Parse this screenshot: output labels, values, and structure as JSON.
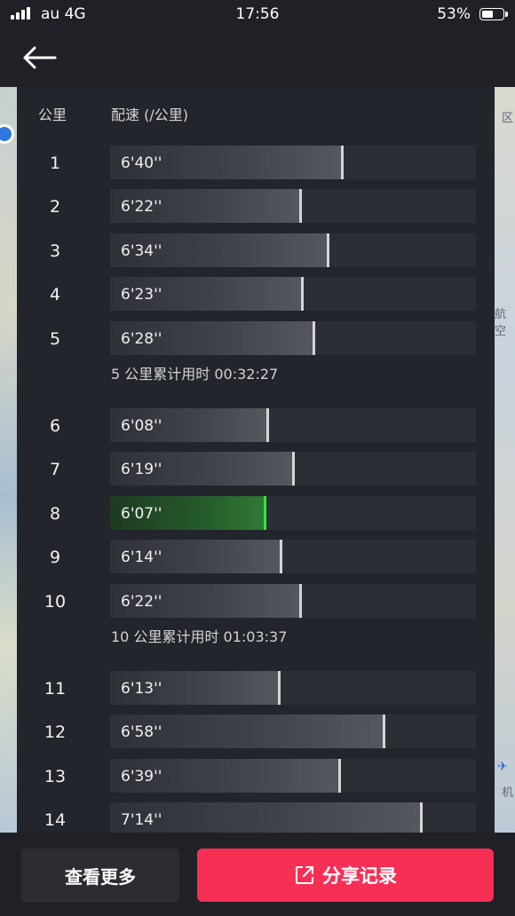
{
  "status_bar": {
    "carrier": "au 4G",
    "time": "17:56",
    "battery": "53%",
    "battery_level": 0.53
  },
  "map_labels": [
    "区",
    "航空",
    "机"
  ],
  "table": {
    "header_km": "公里",
    "header_pace": "配速 (/公里)",
    "rows": [
      {
        "km": "1",
        "pace": "6'40''",
        "seconds": 400
      },
      {
        "km": "2",
        "pace": "6'22''",
        "seconds": 382
      },
      {
        "km": "3",
        "pace": "6'34''",
        "seconds": 394
      },
      {
        "km": "4",
        "pace": "6'23''",
        "seconds": 383
      },
      {
        "km": "5",
        "pace": "6'28''",
        "seconds": 388
      },
      {
        "km": "6",
        "pace": "6'08''",
        "seconds": 368
      },
      {
        "km": "7",
        "pace": "6'19''",
        "seconds": 379
      },
      {
        "km": "8",
        "pace": "6'07''",
        "seconds": 367,
        "fastest": true
      },
      {
        "km": "9",
        "pace": "6'14''",
        "seconds": 374
      },
      {
        "km": "10",
        "pace": "6'22''",
        "seconds": 382
      },
      {
        "km": "11",
        "pace": "6'13''",
        "seconds": 373
      },
      {
        "km": "12",
        "pace": "6'58''",
        "seconds": 418
      },
      {
        "km": "13",
        "pace": "6'39''",
        "seconds": 399
      },
      {
        "km": "14",
        "pace": "7'14''",
        "seconds": 434
      }
    ],
    "summaries": [
      {
        "after_row": 5,
        "text": "5  公里累计用时 00:32:27"
      },
      {
        "after_row": 10,
        "text": "10  公里累计用时 01:03:37"
      }
    ]
  },
  "buttons": {
    "more": "查看更多",
    "share": "分享记录"
  },
  "colors": {
    "accent": "#f72f55",
    "fastest": "#33e83a"
  }
}
